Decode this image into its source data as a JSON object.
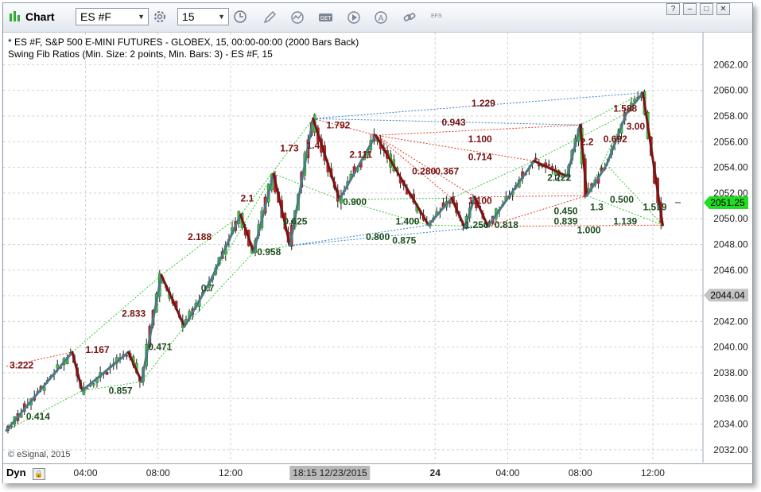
{
  "toolbar": {
    "title": "Chart",
    "symbol": "ES #F",
    "interval": "15",
    "efs_label": "EFS",
    "window_buttons": [
      "?",
      "–",
      "□",
      "✕"
    ]
  },
  "chart_header": {
    "line1": "* ES #F, S&P 500 E-MINI FUTURES - GLOBEX, 15, 00:00-00:00 (2000 Bars Back)",
    "line2": "Swing Fib Ratios (Min. Size: 2 points, Min. Bars: 3) - ES #F, 15"
  },
  "footer": {
    "mode_label": "Dyn",
    "copyright": "© eSignal, 2015",
    "crosshair_time": "18:15  12/23/2015"
  },
  "chart_data": {
    "type": "candlestick",
    "y_axis_ticks": [
      "2032.00",
      "2034.00",
      "2036.00",
      "2038.00",
      "2040.00",
      "2042.00",
      "2044.00",
      "2046.00",
      "2048.00",
      "2050.00",
      "2052.00",
      "2054.00",
      "2056.00",
      "2058.00",
      "2060.00",
      "2062.00"
    ],
    "ylim": [
      2031,
      2064.5
    ],
    "x_axis_ticks": [
      "04:00",
      "08:00",
      "12:00",
      "24",
      "04:00",
      "08:00",
      "12:00"
    ],
    "last_price": "2051.25",
    "cursor_price": "2044.04",
    "colors": {
      "up": "#37c837",
      "down": "#cc1f1f",
      "zigzag_up": "#4a7a86",
      "zigzag_down": "#7a1414",
      "label_high": "#7a1010",
      "label_low": "#1f4d1f",
      "last_price_bg": "#22dd22"
    },
    "swing_points": [
      {
        "bar": 0,
        "price": 2033.5
      },
      {
        "bar": 20,
        "price": 2039.6
      },
      {
        "bar": 23,
        "price": 2036.6
      },
      {
        "bar": 37,
        "price": 2039.6
      },
      {
        "bar": 41,
        "price": 2037.3
      },
      {
        "bar": 47,
        "price": 2045.6
      },
      {
        "bar": 54,
        "price": 2041.6
      },
      {
        "bar": 62,
        "price": 2045.2
      },
      {
        "bar": 71,
        "price": 2050.3
      },
      {
        "bar": 75,
        "price": 2047.4
      },
      {
        "bar": 81,
        "price": 2053.5
      },
      {
        "bar": 86,
        "price": 2047.9
      },
      {
        "bar": 93,
        "price": 2057.8
      },
      {
        "bar": 101,
        "price": 2051.5
      },
      {
        "bar": 112,
        "price": 2056.5
      },
      {
        "bar": 128,
        "price": 2049.5
      },
      {
        "bar": 135,
        "price": 2051.6
      },
      {
        "bar": 139,
        "price": 2049.3
      },
      {
        "bar": 142,
        "price": 2051.7
      },
      {
        "bar": 146,
        "price": 2049.4
      },
      {
        "bar": 160,
        "price": 2054.5
      },
      {
        "bar": 170,
        "price": 2053.3
      },
      {
        "bar": 174,
        "price": 2057.3
      },
      {
        "bar": 176,
        "price": 2051.8
      },
      {
        "bar": 182,
        "price": 2054.2
      },
      {
        "bar": 188,
        "price": 2058.2
      },
      {
        "bar": 193,
        "price": 2059.8
      },
      {
        "bar": 199,
        "price": 2049.5
      }
    ],
    "ratio_labels": [
      {
        "text": "3.222",
        "bar": 1,
        "price": 2038.6,
        "kind": "high"
      },
      {
        "text": "0.414",
        "bar": 6,
        "price": 2034.6,
        "kind": "low"
      },
      {
        "text": "1.167",
        "bar": 24,
        "price": 2039.8,
        "kind": "high"
      },
      {
        "text": "0.857",
        "bar": 31,
        "price": 2036.6,
        "kind": "low"
      },
      {
        "text": "2.833",
        "bar": 35,
        "price": 2042.6,
        "kind": "high"
      },
      {
        "text": "0.471",
        "bar": 43,
        "price": 2040.0,
        "kind": "low"
      },
      {
        "text": "0.7",
        "bar": 59,
        "price": 2044.6,
        "kind": "low"
      },
      {
        "text": "2.188",
        "bar": 55,
        "price": 2048.6,
        "kind": "high"
      },
      {
        "text": "2.1",
        "bar": 71,
        "price": 2051.6,
        "kind": "high"
      },
      {
        "text": "0.625",
        "bar": 84,
        "price": 2049.8,
        "kind": "low"
      },
      {
        "text": "0.958",
        "bar": 76,
        "price": 2047.4,
        "kind": "low"
      },
      {
        "text": "1.73",
        "bar": 83,
        "price": 2055.5,
        "kind": "high"
      },
      {
        "text": "1.792",
        "bar": 97,
        "price": 2057.3,
        "kind": "high"
      },
      {
        "text": "1.4",
        "bar": 91,
        "price": 2055.7,
        "kind": "high"
      },
      {
        "text": "2.111",
        "bar": 104,
        "price": 2055.0,
        "kind": "high"
      },
      {
        "text": "0.900",
        "bar": 102,
        "price": 2051.3,
        "kind": "low"
      },
      {
        "text": "1.400",
        "bar": 118,
        "price": 2049.8,
        "kind": "low"
      },
      {
        "text": "0.280",
        "bar": 123,
        "price": 2053.7,
        "kind": "high"
      },
      {
        "text": "0.367",
        "bar": 130,
        "price": 2053.7,
        "kind": "high"
      },
      {
        "text": "0.943",
        "bar": 132,
        "price": 2057.5,
        "kind": "high"
      },
      {
        "text": "1.100",
        "bar": 140,
        "price": 2056.2,
        "kind": "high"
      },
      {
        "text": "0.714",
        "bar": 140,
        "price": 2054.8,
        "kind": "high"
      },
      {
        "text": "1.229",
        "bar": 141,
        "price": 2059.0,
        "kind": "high"
      },
      {
        "text": "1.100",
        "bar": 140,
        "price": 2051.4,
        "kind": "high"
      },
      {
        "text": "0.800",
        "bar": 109,
        "price": 2048.6,
        "kind": "low"
      },
      {
        "text": "0.875",
        "bar": 117,
        "price": 2048.3,
        "kind": "low"
      },
      {
        "text": "1.250",
        "bar": 139,
        "price": 2049.5,
        "kind": "low"
      },
      {
        "text": "0.818",
        "bar": 148,
        "price": 2049.5,
        "kind": "low"
      },
      {
        "text": "2.222",
        "bar": 164,
        "price": 2053.2,
        "kind": "low"
      },
      {
        "text": "0.450",
        "bar": 166,
        "price": 2050.6,
        "kind": "low"
      },
      {
        "text": "0.839",
        "bar": 166,
        "price": 2049.8,
        "kind": "low"
      },
      {
        "text": "1.000",
        "bar": 173,
        "price": 2049.1,
        "kind": "low"
      },
      {
        "text": "2.2",
        "bar": 174,
        "price": 2056.0,
        "kind": "high"
      },
      {
        "text": "0.692",
        "bar": 181,
        "price": 2056.2,
        "kind": "high"
      },
      {
        "text": "1.588",
        "bar": 184,
        "price": 2058.6,
        "kind": "high"
      },
      {
        "text": "3.00",
        "bar": 188,
        "price": 2057.2,
        "kind": "high"
      },
      {
        "text": "1.3",
        "bar": 177,
        "price": 2050.9,
        "kind": "low"
      },
      {
        "text": "0.500",
        "bar": 183,
        "price": 2051.5,
        "kind": "low"
      },
      {
        "text": "1.139",
        "bar": 184,
        "price": 2049.8,
        "kind": "low"
      },
      {
        "text": "1.519",
        "bar": 193,
        "price": 2050.9,
        "kind": "low"
      }
    ],
    "connector_lines": [
      {
        "from_bar": 0,
        "from_price": 2038.5,
        "to_bar": 20,
        "to_price": 2039.6,
        "color": "red"
      },
      {
        "from_bar": 23,
        "from_price": 2036.6,
        "to_bar": 41,
        "to_price": 2037.3,
        "color": "green"
      },
      {
        "from_bar": 0,
        "from_price": 2033.5,
        "to_bar": 23,
        "to_price": 2036.6,
        "color": "green"
      },
      {
        "from_bar": 20,
        "from_price": 2039.6,
        "to_bar": 47,
        "to_price": 2045.6,
        "color": "green"
      },
      {
        "from_bar": 41,
        "from_price": 2037.3,
        "to_bar": 54,
        "to_price": 2041.6,
        "color": "green"
      },
      {
        "from_bar": 47,
        "from_price": 2045.6,
        "to_bar": 71,
        "to_price": 2050.3,
        "color": "green"
      },
      {
        "from_bar": 54,
        "from_price": 2041.6,
        "to_bar": 75,
        "to_price": 2047.4,
        "color": "green"
      },
      {
        "from_bar": 62,
        "from_price": 2045.2,
        "to_bar": 81,
        "to_price": 2053.5,
        "color": "green"
      },
      {
        "from_bar": 71,
        "from_price": 2050.3,
        "to_bar": 93,
        "to_price": 2057.8,
        "color": "green"
      },
      {
        "from_bar": 75,
        "from_price": 2047.4,
        "to_bar": 86,
        "to_price": 2047.9,
        "color": "green"
      },
      {
        "from_bar": 81,
        "from_price": 2053.5,
        "to_bar": 101,
        "to_price": 2051.5,
        "color": "green"
      },
      {
        "from_bar": 86,
        "from_price": 2047.9,
        "to_bar": 146,
        "to_price": 2049.4,
        "color": "blue"
      },
      {
        "from_bar": 86,
        "from_price": 2047.9,
        "to_bar": 128,
        "to_price": 2049.5,
        "color": "blue"
      },
      {
        "from_bar": 93,
        "from_price": 2057.8,
        "to_bar": 193,
        "to_price": 2059.8,
        "color": "blue"
      },
      {
        "from_bar": 93,
        "from_price": 2057.8,
        "to_bar": 174,
        "to_price": 2057.3,
        "color": "blue"
      },
      {
        "from_bar": 93,
        "from_price": 2057.8,
        "to_bar": 112,
        "to_price": 2056.5,
        "color": "red"
      },
      {
        "from_bar": 101,
        "from_price": 2051.5,
        "to_bar": 128,
        "to_price": 2049.5,
        "color": "green"
      },
      {
        "from_bar": 101,
        "from_price": 2051.5,
        "to_bar": 135,
        "to_price": 2051.6,
        "color": "green"
      },
      {
        "from_bar": 112,
        "from_price": 2056.5,
        "to_bar": 174,
        "to_price": 2057.3,
        "color": "red"
      },
      {
        "from_bar": 112,
        "from_price": 2056.5,
        "to_bar": 160,
        "to_price": 2054.5,
        "color": "red"
      },
      {
        "from_bar": 112,
        "from_price": 2056.5,
        "to_bar": 135,
        "to_price": 2051.6,
        "color": "red"
      },
      {
        "from_bar": 112,
        "from_price": 2056.5,
        "to_bar": 142,
        "to_price": 2051.7,
        "color": "red"
      },
      {
        "from_bar": 128,
        "from_price": 2049.5,
        "to_bar": 146,
        "to_price": 2049.4,
        "color": "green"
      },
      {
        "from_bar": 135,
        "from_price": 2051.6,
        "to_bar": 160,
        "to_price": 2054.5,
        "color": "green"
      },
      {
        "from_bar": 146,
        "from_price": 2049.4,
        "to_bar": 199,
        "to_price": 2049.5,
        "color": "red"
      },
      {
        "from_bar": 146,
        "from_price": 2049.4,
        "to_bar": 176,
        "to_price": 2051.8,
        "color": "red"
      },
      {
        "from_bar": 142,
        "from_price": 2051.7,
        "to_bar": 176,
        "to_price": 2051.8,
        "color": "red"
      },
      {
        "from_bar": 160,
        "from_price": 2054.5,
        "to_bar": 188,
        "to_price": 2058.2,
        "color": "green"
      },
      {
        "from_bar": 176,
        "from_price": 2051.8,
        "to_bar": 199,
        "to_price": 2049.5,
        "color": "green"
      },
      {
        "from_bar": 174,
        "from_price": 2057.3,
        "to_bar": 193,
        "to_price": 2059.8,
        "color": "green"
      },
      {
        "from_bar": 176,
        "from_price": 2051.8,
        "to_bar": 188,
        "to_price": 2058.2,
        "color": "green"
      },
      {
        "from_bar": 182,
        "from_price": 2054.2,
        "to_bar": 199,
        "to_price": 2049.5,
        "color": "green"
      }
    ],
    "grid": true
  }
}
